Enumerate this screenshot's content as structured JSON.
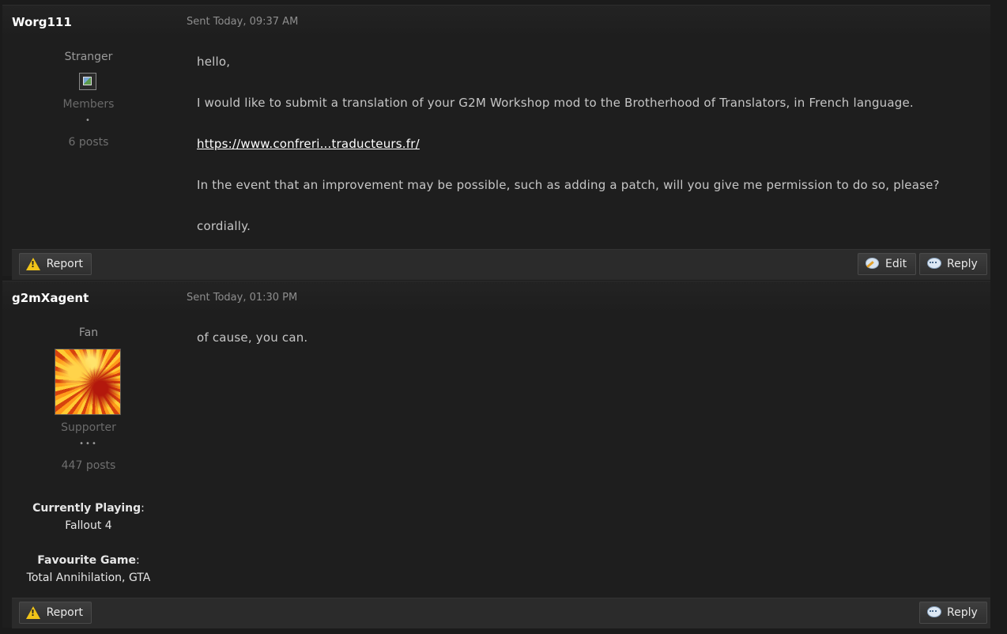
{
  "posts": [
    {
      "author": "Worg111",
      "date": "Sent Today, 09:37 AM",
      "rank": "Stranger",
      "group": "Members",
      "pips": "•",
      "post_count": "6 posts",
      "body": {
        "greeting": "hello,",
        "line1": "I would like to submit a translation of your G2M Workshop mod to the Brotherhood of Translators, in French language.",
        "link": "https://www.confreri...traducteurs.fr/",
        "line2": "In the event that an improvement may be possible, such as adding a patch, will you give me permission to do so, please?",
        "closing": "cordially."
      },
      "buttons": {
        "report": "Report",
        "edit": "Edit",
        "reply": "Reply"
      }
    },
    {
      "author": "g2mXagent",
      "date": "Sent Today, 01:30 PM",
      "rank": "Fan",
      "group": "Supporter",
      "pips": "•••",
      "post_count": "447 posts",
      "fields": [
        {
          "label": "Currently Playing",
          "value": "Fallout 4"
        },
        {
          "label": "Favourite Game",
          "value": "Total Annihilation, GTA"
        }
      ],
      "body": {
        "text": "of cause, you can."
      },
      "buttons": {
        "report": "Report",
        "reply": "Reply"
      }
    }
  ]
}
